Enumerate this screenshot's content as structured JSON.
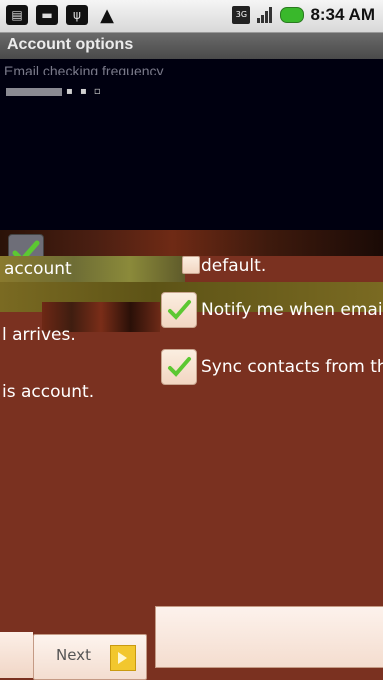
{
  "status_bar": {
    "time": "8:34 AM",
    "network_label": "3G",
    "left_icons": [
      "notification-icon",
      "chat-icon",
      "usb-icon",
      "warning-icon"
    ],
    "right_icons": [
      "3g-icon",
      "signal-icon",
      "battery-icon"
    ]
  },
  "title_bar": {
    "title": "Account options"
  },
  "settings": {
    "frequency_label": "Email checking frequency",
    "default_account_line1": "account",
    "default_account_line2": "default.",
    "notify_line1": "Notify me when emai",
    "notify_line2": "l arrives.",
    "sync_line1": "Sync contacts from th",
    "sync_line2": "is account."
  },
  "checkboxes": {
    "default_account": true,
    "notify": true,
    "sync_contacts": true
  },
  "bottom": {
    "next_label": "Next"
  },
  "colors": {
    "background": "#7a3120",
    "titlebar": "#555555",
    "check_green": "#5cc832",
    "next_arrow": "#f2c72e"
  }
}
